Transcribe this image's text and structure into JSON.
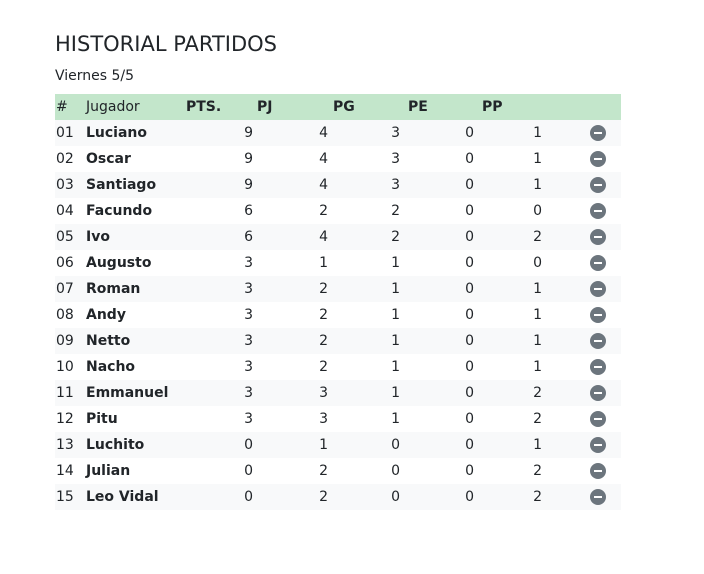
{
  "title": "HISTORIAL PARTIDOS",
  "subtitle": "Viernes 5/5",
  "table": {
    "headers": {
      "idx": "#",
      "player": "Jugador",
      "pts": "PTS.",
      "pj": "PJ",
      "pg": "PG",
      "pe": "PE",
      "pp": "PP"
    },
    "header_color": "#c3e6cb",
    "rows": [
      {
        "idx": "01",
        "player": "Luciano",
        "pts": "9",
        "pj": "4",
        "pg": "3",
        "pe": "0",
        "pp": "1"
      },
      {
        "idx": "02",
        "player": "Oscar",
        "pts": "9",
        "pj": "4",
        "pg": "3",
        "pe": "0",
        "pp": "1"
      },
      {
        "idx": "03",
        "player": "Santiago",
        "pts": "9",
        "pj": "4",
        "pg": "3",
        "pe": "0",
        "pp": "1"
      },
      {
        "idx": "04",
        "player": "Facundo",
        "pts": "6",
        "pj": "2",
        "pg": "2",
        "pe": "0",
        "pp": "0"
      },
      {
        "idx": "05",
        "player": "Ivo",
        "pts": "6",
        "pj": "4",
        "pg": "2",
        "pe": "0",
        "pp": "2"
      },
      {
        "idx": "06",
        "player": "Augusto",
        "pts": "3",
        "pj": "1",
        "pg": "1",
        "pe": "0",
        "pp": "0"
      },
      {
        "idx": "07",
        "player": "Roman",
        "pts": "3",
        "pj": "2",
        "pg": "1",
        "pe": "0",
        "pp": "1"
      },
      {
        "idx": "08",
        "player": "Andy",
        "pts": "3",
        "pj": "2",
        "pg": "1",
        "pe": "0",
        "pp": "1"
      },
      {
        "idx": "09",
        "player": "Netto",
        "pts": "3",
        "pj": "2",
        "pg": "1",
        "pe": "0",
        "pp": "1"
      },
      {
        "idx": "10",
        "player": "Nacho",
        "pts": "3",
        "pj": "2",
        "pg": "1",
        "pe": "0",
        "pp": "1"
      },
      {
        "idx": "11",
        "player": "Emmanuel",
        "pts": "3",
        "pj": "3",
        "pg": "1",
        "pe": "0",
        "pp": "2"
      },
      {
        "idx": "12",
        "player": "Pitu",
        "pts": "3",
        "pj": "3",
        "pg": "1",
        "pe": "0",
        "pp": "2"
      },
      {
        "idx": "13",
        "player": "Luchito",
        "pts": "0",
        "pj": "1",
        "pg": "0",
        "pe": "0",
        "pp": "1"
      },
      {
        "idx": "14",
        "player": "Julian",
        "pts": "0",
        "pj": "2",
        "pg": "0",
        "pe": "0",
        "pp": "2"
      },
      {
        "idx": "15",
        "player": "Leo Vidal",
        "pts": "0",
        "pj": "2",
        "pg": "0",
        "pe": "0",
        "pp": "2"
      }
    ],
    "row_action_icon": "remove-icon"
  }
}
